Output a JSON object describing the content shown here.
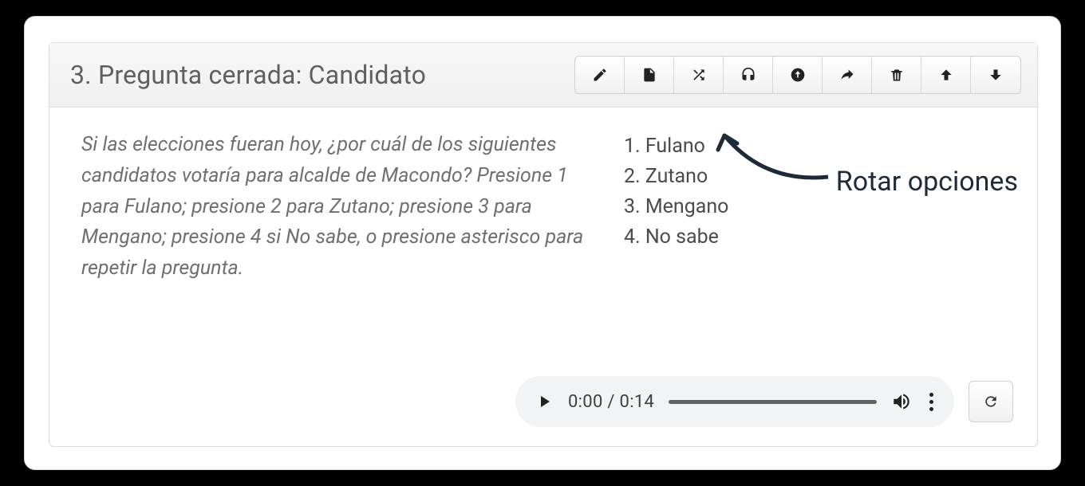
{
  "question": {
    "title": "3. Pregunta cerrada: Candidato",
    "text": "Si las elecciones fueran hoy, ¿por cuál de los siguientes candidatos votaría para alcalde de Macondo? Presione 1 para Fulano; presione 2 para Zutano; presione 3 para Mengano; presione 4 si No sabe, o presione asterisco para repetir la pregunta.",
    "options": [
      "Fulano",
      "Zutano",
      "Mengano",
      "No sabe"
    ]
  },
  "toolbar": {
    "edit": "edit",
    "copy": "copy",
    "shuffle": "shuffle",
    "audio": "audio",
    "upload": "upload",
    "share": "share",
    "delete": "delete",
    "move_up": "up",
    "move_down": "down"
  },
  "annotation": {
    "label": "Rotar opciones"
  },
  "audio": {
    "current": "0:00",
    "total": "0:14"
  }
}
